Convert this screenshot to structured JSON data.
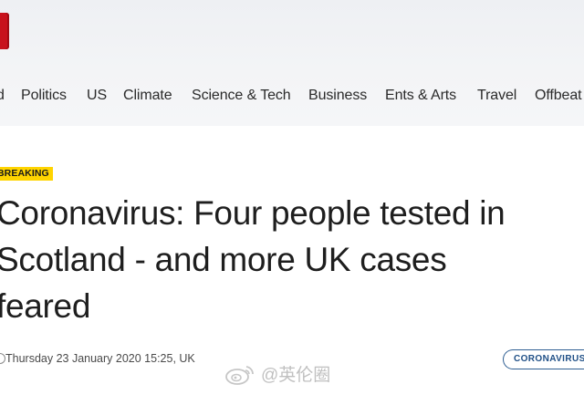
{
  "header": {
    "nav_items": [
      {
        "label": "d"
      },
      {
        "label": "Politics"
      },
      {
        "label": "US"
      },
      {
        "label": "Climate"
      },
      {
        "label": "Science & Tech"
      },
      {
        "label": "Business"
      },
      {
        "label": "Ents & Arts"
      },
      {
        "label": "Travel"
      },
      {
        "label": "Offbeat"
      }
    ]
  },
  "article": {
    "badge": "BREAKING",
    "headline": "Coronavirus: Four people tested in Scotland - and more UK cases feared",
    "headline_lines": [
      "Coronavirus: Four people tested in",
      "Scotland - and more UK cases",
      "feared"
    ],
    "timestamp": "Thursday 23 January 2020 15:25, UK",
    "topic_tag": "CORONAVIRUS"
  },
  "watermark": {
    "text": "@英伦圈",
    "icon": "weibo-icon"
  },
  "colors": {
    "brand_red": "#c8121c",
    "badge_yellow": "#ffd400",
    "tag_blue": "#2f5f93"
  }
}
